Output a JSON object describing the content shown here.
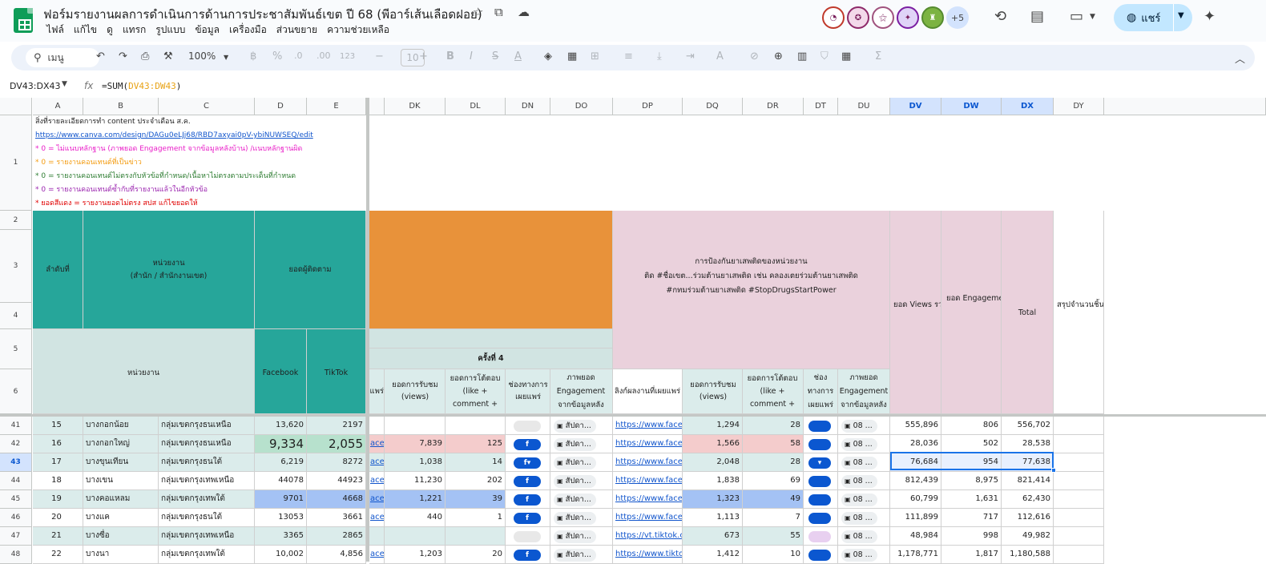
{
  "app": {
    "title": "ฟอร์มรายงานผลการดำเนินการด้านการประชาสัมพันธ์เขต ปี 68 (พีอาร์เส้นเลือดฝอย)",
    "menu": [
      "ไฟล์",
      "แก้ไข",
      "ดู",
      "แทรก",
      "รูปแบบ",
      "ข้อมูล",
      "เครื่องมือ",
      "ส่วนขยาย",
      "ความช่วยเหลือ"
    ],
    "share_label": "แชร์",
    "more_collaborators": "+5"
  },
  "toolbar": {
    "search_label": "เมนู",
    "zoom": "100%",
    "currency": "฿",
    "percent": "%",
    "dec_decrease": ".0",
    "dec_increase": ".00",
    "format_123": "123",
    "font_size": "10"
  },
  "formula_bar": {
    "name_box": "DV43:DX43",
    "fx": "fx",
    "formula_prefix": "=SUM(",
    "formula_range": "DV43:DW43",
    "formula_suffix": ")"
  },
  "columns": [
    "A",
    "B",
    "C",
    "D",
    "E",
    "DK",
    "DL",
    "DN",
    "DO",
    "DP",
    "DQ",
    "DR",
    "DT",
    "DU",
    "DV",
    "DW",
    "DX",
    "DY"
  ],
  "row_numbers": [
    "1",
    "2",
    "3",
    "4",
    "5",
    "6",
    "41",
    "42",
    "43",
    "44",
    "45",
    "46",
    "47",
    "48"
  ],
  "notes": [
    {
      "text": "สิ่งที่รายละเอียดการทำ content ประจำเดือน ส.ค.",
      "color": "#1f1f1f"
    },
    {
      "text": "https://www.canva.com/design/DAGu0eLJj68/RBD7axyai0pV-ybiNUWSEQ/edit",
      "color": "#1155cc"
    },
    {
      "text": "* 0 = ไม่แนบหลักฐาน (ภาพยอด Engagement จากข้อมูลหลังบ้าน) /แนบหลักฐานผิด",
      "color": "#e91ec8"
    },
    {
      "text": "* 0 = รายงานคอนเทนต์ที่เป็นข่าว",
      "color": "#f39c12"
    },
    {
      "text": "* 0 = รายงานคอนเทนต์ไม่ตรงกับหัวข้อที่กำหนด/เนื้อหาไม่ตรงตามประเด็นที่กำหนด",
      "color": "#2e7d32"
    },
    {
      "text": "* 0 = รายงานคอนเทนต์ซ้ำกับที่รายงานแล้วในอีกหัวข้อ",
      "color": "#9c27b0"
    },
    {
      "text": "* ยอดสีแดง = รายงานยอดไม่ตรง สปส แก้ไขยอดให้",
      "color": "#e00000"
    }
  ],
  "headers": {
    "seq": "ลำดับที่",
    "unit": "หน่วยงาน",
    "unit_sub": "(สำนัก / สำนักงานเขต)",
    "followers": "ยอดผู้ติดตาม",
    "unit_row5": "หน่วยงาน",
    "facebook": "Facebook",
    "tiktok": "TikTok",
    "round4": "ครั้งที่ 4",
    "prevention_line1": "การป้องกันยาเสพติดของหน่วยงาน",
    "prevention_line2": "ติด #ชื่อเขต...ร่วมต้านยาเสพติด เช่น คลองเตยร่วมต้านยาเสพติด",
    "prevention_line3": "#กทมร่วมต้านยาเสพติด #StopDrugsStartPower",
    "views_total": "ยอด Views รวม",
    "engagement_total": "ยอด Engagement รวม",
    "total": "Total",
    "summary_count": "สรุปจำนวนชิ้นงาน",
    "dk_trunc": "แพร่",
    "views": "ยอดการรับชม (views)",
    "engagement": "ยอดการโต้ตอบ (like + comment +",
    "channel": "ช่องทางการเผยแพร่",
    "eng_image": "ภาพยอด Engagement จากข้อมูลหลัง",
    "link_label": "ลิงก์ผลงานที่เผยแพร่",
    "channel2": "ช่องทางการเผยแพร่"
  },
  "rows": [
    {
      "n": "15",
      "district": "บางกอกน้อย",
      "group": "กลุ่มเขตกรุงธนเหนือ",
      "fb": "13,620",
      "tt": "2197",
      "dk_link": "",
      "dk_views": "",
      "dl_eng": "",
      "dn": "",
      "do_chip": "สัปดา...",
      "dp_link": "https://www.face",
      "dq": "1,294",
      "dr": "28",
      "dt": "",
      "du_chip": "08 ...",
      "dv": "555,896",
      "dw": "806",
      "dx": "556,702"
    },
    {
      "n": "16",
      "district": "บางกอกใหญ่",
      "group": "กลุ่มเขตกรุงธนเหนือ",
      "fb": "9,334",
      "tt": "2,055",
      "dk_link": "ace",
      "dk_views": "7,839",
      "dl_eng": "125",
      "dn": "f",
      "do_chip": "สัปดา...",
      "dp_link": "https://www.face",
      "dq": "1,566",
      "dr": "58",
      "dt": "",
      "du_chip": "08 ...",
      "dv": "28,036",
      "dw": "502",
      "dx": "28,538"
    },
    {
      "n": "17",
      "district": "บางขุนเทียน",
      "group": "กลุ่มเขตกรุงธนใต้",
      "fb": "6,219",
      "tt": "8272",
      "dk_link": "ace",
      "dk_views": "1,038",
      "dl_eng": "14",
      "dn": "f▾",
      "do_chip": "สัปดา...",
      "dp_link": "https://www.face",
      "dq": "2,048",
      "dr": "28",
      "dt": "▾",
      "du_chip": "08 ...",
      "dv": "76,684",
      "dw": "954",
      "dx": "77,638"
    },
    {
      "n": "18",
      "district": "บางเขน",
      "group": "กลุ่มเขตกรุงเทพเหนือ",
      "fb": "44078",
      "tt": "44923",
      "dk_link": "ace",
      "dk_views": "11,230",
      "dl_eng": "202",
      "dn": "f",
      "do_chip": "สัปดา...",
      "dp_link": "https://www.face",
      "dq": "1,838",
      "dr": "69",
      "dt": "",
      "du_chip": "08 ...",
      "dv": "812,439",
      "dw": "8,975",
      "dx": "821,414"
    },
    {
      "n": "19",
      "district": "บางคอแหลม",
      "group": "กลุ่มเขตกรุงเทพใต้",
      "fb": "9701",
      "tt": "4668",
      "dk_link": "ace",
      "dk_views": "1,221",
      "dl_eng": "39",
      "dn": "f",
      "do_chip": "สัปดา...",
      "dp_link": "https://www.face",
      "dq": "1,323",
      "dr": "49",
      "dt": "",
      "du_chip": "08 ...",
      "dv": "60,799",
      "dw": "1,631",
      "dx": "62,430"
    },
    {
      "n": "20",
      "district": "บางแค",
      "group": "กลุ่มเขตกรุงธนใต้",
      "fb": "13053",
      "tt": "3661",
      "dk_link": "ace",
      "dk_views": "440",
      "dl_eng": "1",
      "dn": "f",
      "do_chip": "สัปดา...",
      "dp_link": "https://www.face",
      "dq": "1,113",
      "dr": "7",
      "dt": "",
      "du_chip": "08 ...",
      "dv": "111,899",
      "dw": "717",
      "dx": "112,616"
    },
    {
      "n": "21",
      "district": "บางซื่อ",
      "group": "กลุ่มเขตกรุงเทพเหนือ",
      "fb": "3365",
      "tt": "2865",
      "dk_link": "",
      "dk_views": "",
      "dl_eng": "",
      "dn": "",
      "do_chip": "สัปดา...",
      "dp_link": "https://vt.tiktok.c",
      "dq": "673",
      "dr": "55",
      "dt": "",
      "du_chip": "08 ...",
      "dv": "48,984",
      "dw": "998",
      "dx": "49,982"
    },
    {
      "n": "22",
      "district": "บางนา",
      "group": "กลุ่มเขตกรุงเทพใต้",
      "fb": "10,002",
      "tt": "4,856",
      "dk_link": "ace",
      "dk_views": "1,203",
      "dl_eng": "20",
      "dn": "f",
      "do_chip": "สัปดา...",
      "dp_link": "https://www.tikto",
      "dq": "1,412",
      "dr": "10",
      "dt": "",
      "du_chip": "08 ...",
      "dv": "1,178,771",
      "dw": "1,817",
      "dx": "1,180,588"
    }
  ]
}
